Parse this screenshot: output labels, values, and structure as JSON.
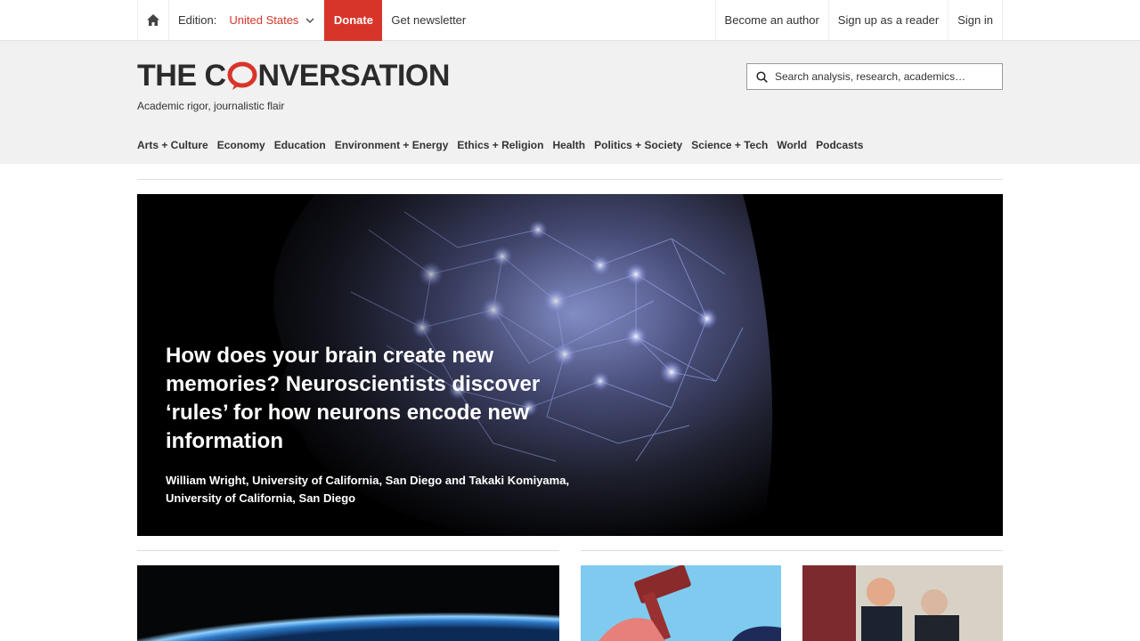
{
  "topbar": {
    "edition_label": "Edition:",
    "edition_value": "United States",
    "donate_label": "Donate",
    "newsletter_label": "Get newsletter",
    "become_author": "Become an author",
    "sign_up": "Sign up as a reader",
    "sign_in": "Sign in"
  },
  "masthead": {
    "logo_text_before": "THE C",
    "logo_text_after": "NVERSATION",
    "tagline": "Academic rigor, journalistic flair",
    "search_placeholder": "Search analysis, research, academics…"
  },
  "nav": {
    "items": [
      "Arts + Culture",
      "Economy",
      "Education",
      "Environment + Energy",
      "Ethics + Religion",
      "Health",
      "Politics + Society",
      "Science + Tech",
      "World",
      "Podcasts"
    ]
  },
  "hero": {
    "title": "How does your brain create new memories? Neuroscientists discover ‘rules’ for how neurons encode new information",
    "authors": "William Wright, University of California, San Diego and Takaki Komiyama, University of California, San Diego"
  },
  "colors": {
    "accent": "#d8352a",
    "masthead_bg": "#f1f1f1"
  },
  "icons": {
    "home": "home-icon",
    "search": "search-icon",
    "edition_toggle": "chevron-down-icon",
    "logo_bubble": "speech-bubble-icon"
  }
}
